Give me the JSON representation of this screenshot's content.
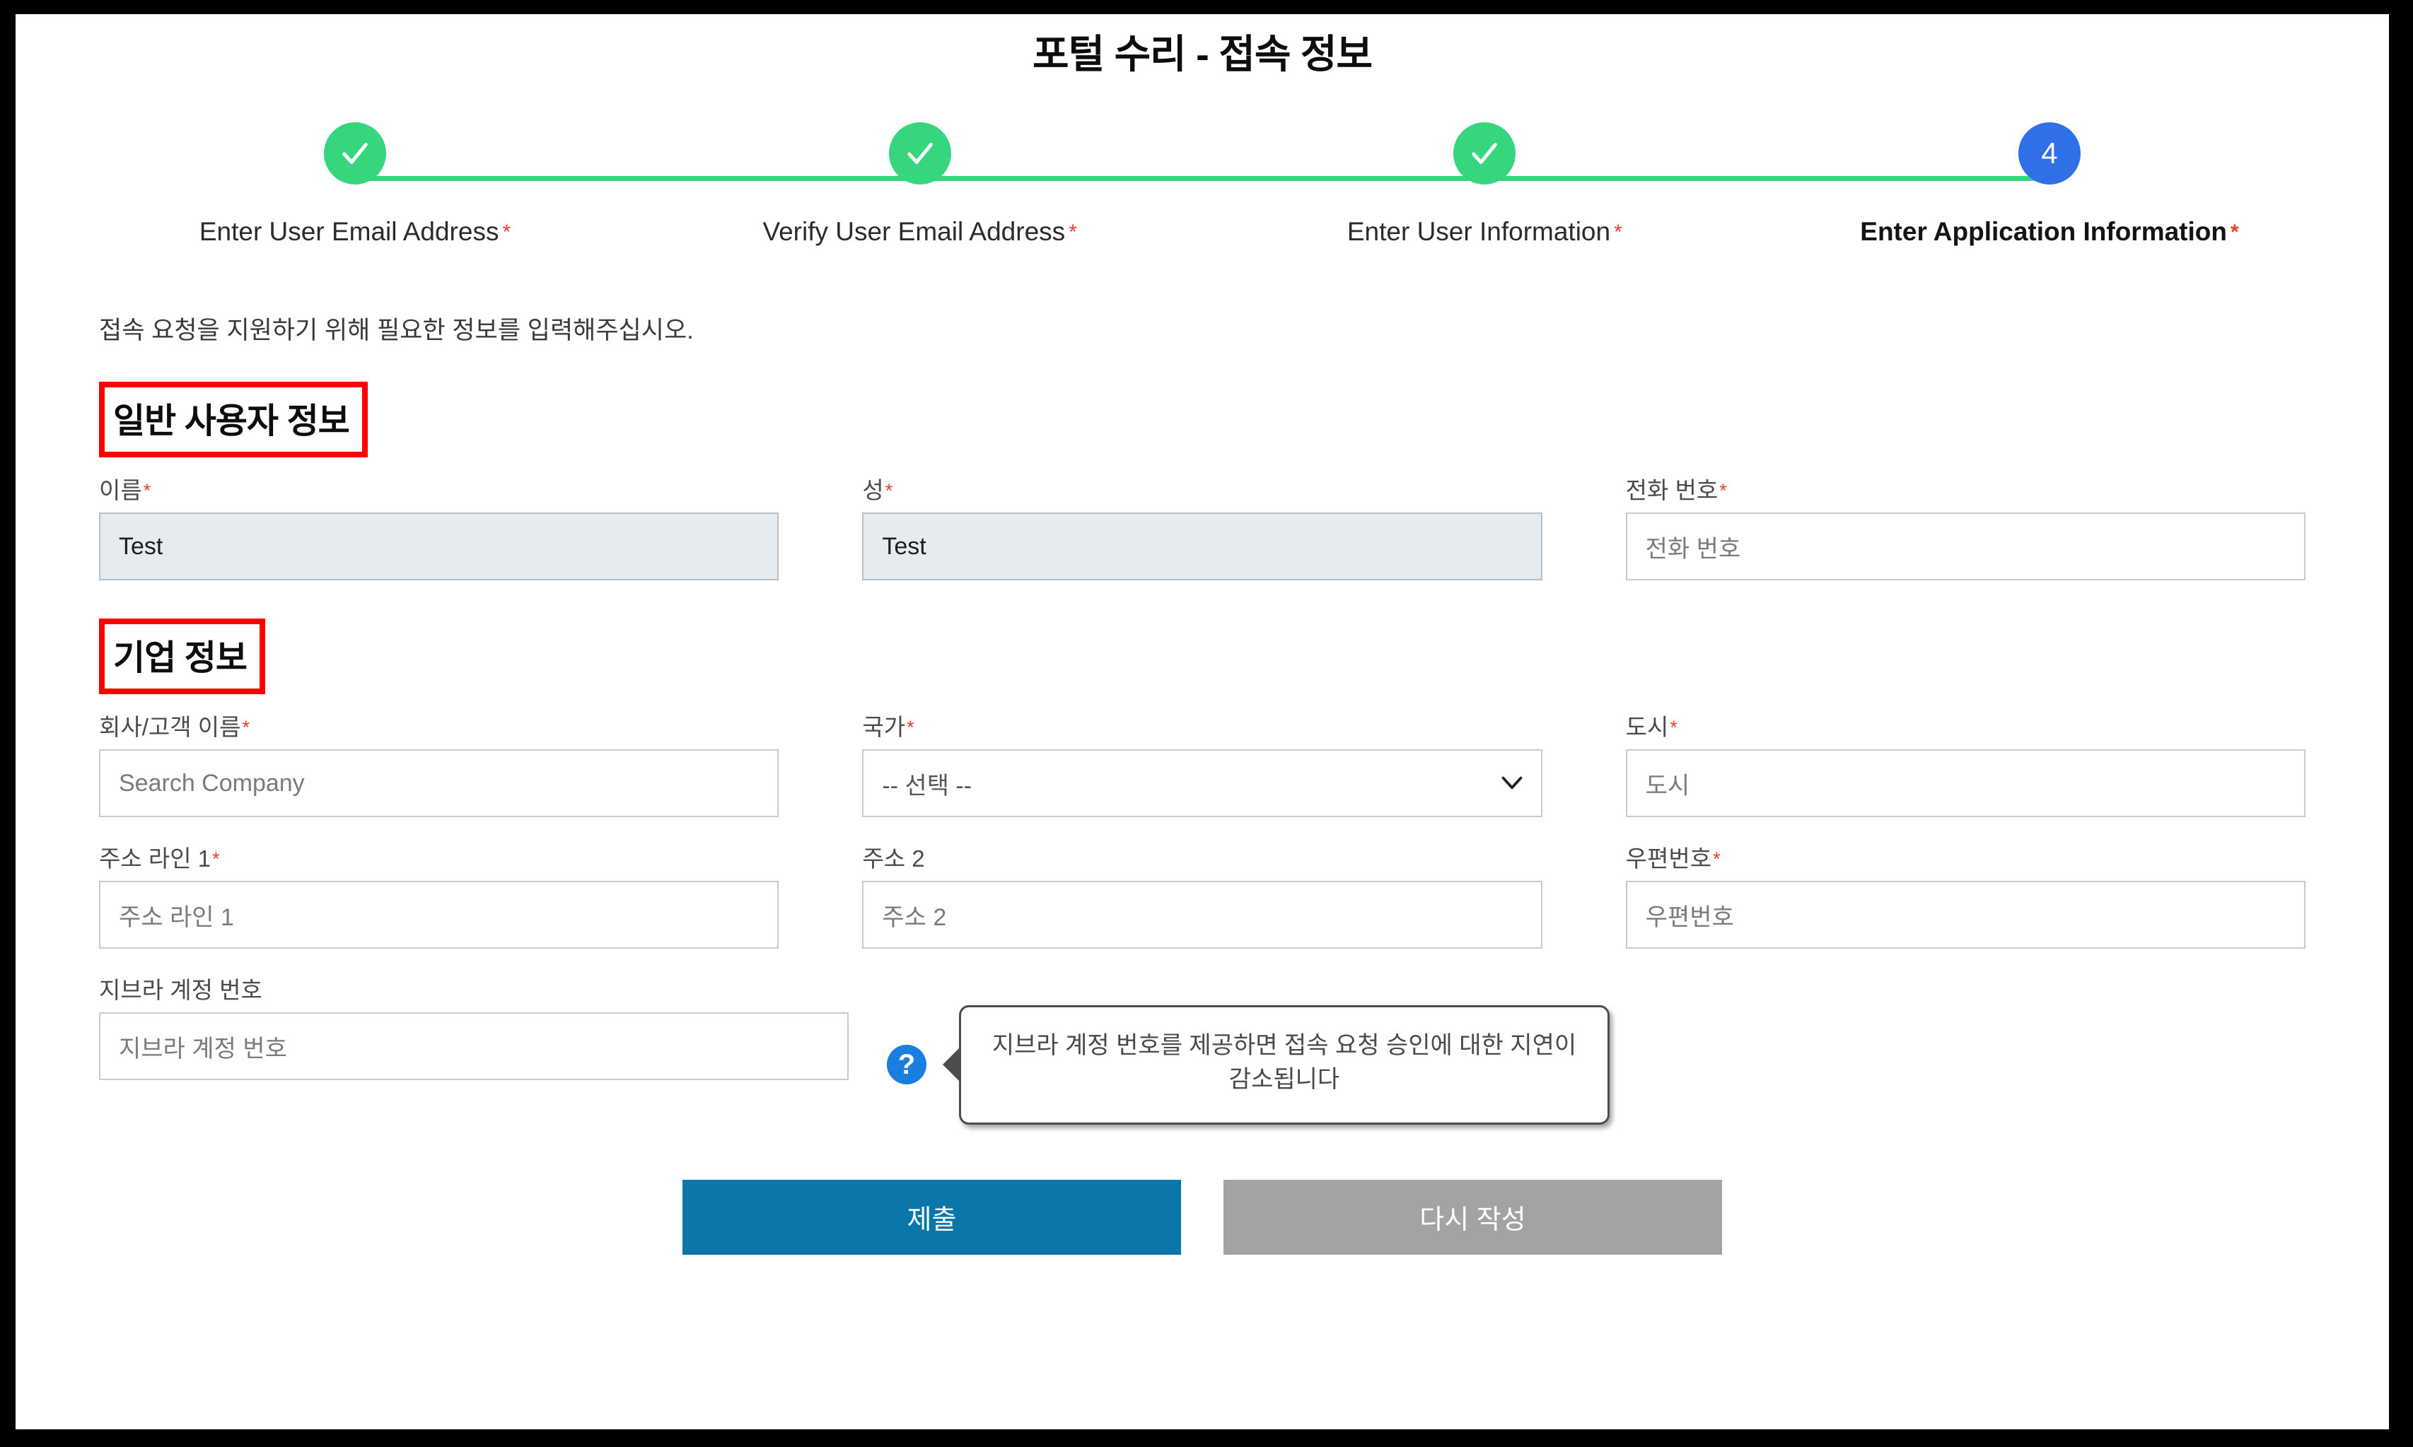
{
  "page": {
    "title": "포털 수리 - 접속 정보",
    "intro": "접속 요청을 지원하기 위해 필요한 정보를 입력해주십시오."
  },
  "colors": {
    "step_done": "#35d67d",
    "step_current": "#2f6fe8",
    "required_asterisk": "#e8402a",
    "annotation_box": "#ff0000",
    "submit_button": "#0a77a8",
    "reset_button": "#a3a3a3",
    "help_icon": "#1a7de0"
  },
  "stepper": {
    "steps": [
      {
        "label": "Enter User Email Address",
        "marker": "✓",
        "state": "done",
        "required": "*"
      },
      {
        "label": "Verify User Email Address",
        "marker": "✓",
        "state": "done",
        "required": "*"
      },
      {
        "label": "Enter User Information",
        "marker": "✓",
        "state": "done",
        "required": "*"
      },
      {
        "label": "Enter Application Information",
        "marker": "4",
        "state": "current",
        "required": "*"
      }
    ]
  },
  "sections": {
    "general_user": {
      "heading": "일반 사용자 정보",
      "fields": {
        "first_name": {
          "label": "이름",
          "required": "*",
          "value": "Test",
          "placeholder": ""
        },
        "last_name": {
          "label": "성",
          "required": "*",
          "value": "Test",
          "placeholder": ""
        },
        "phone": {
          "label": "전화 번호",
          "required": "*",
          "value": "",
          "placeholder": "전화 번호"
        }
      }
    },
    "company": {
      "heading": "기업 정보",
      "fields": {
        "company_name": {
          "label": "회사/고객 이름",
          "required": "*",
          "value": "",
          "placeholder": "Search Company"
        },
        "country": {
          "label": "국가",
          "required": "*",
          "selected": "-- 선택 --"
        },
        "city": {
          "label": "도시",
          "required": "*",
          "value": "",
          "placeholder": "도시"
        },
        "address1": {
          "label": "주소 라인 1",
          "required": "*",
          "value": "",
          "placeholder": "주소 라인 1"
        },
        "address2": {
          "label": "주소 2",
          "required": "",
          "value": "",
          "placeholder": "주소 2"
        },
        "postal_code": {
          "label": "우편번호",
          "required": "*",
          "value": "",
          "placeholder": "우편번호"
        },
        "zebra_account": {
          "label": "지브라 계정 번호",
          "required": "",
          "value": "",
          "placeholder": "지브라 계정 번호"
        }
      },
      "tooltip": "지브라 계정 번호를 제공하면 접속 요청 승인에 대한 지연이 감소됩니다",
      "help_icon_glyph": "?"
    }
  },
  "actions": {
    "submit_label": "제출",
    "reset_label": "다시 작성"
  }
}
